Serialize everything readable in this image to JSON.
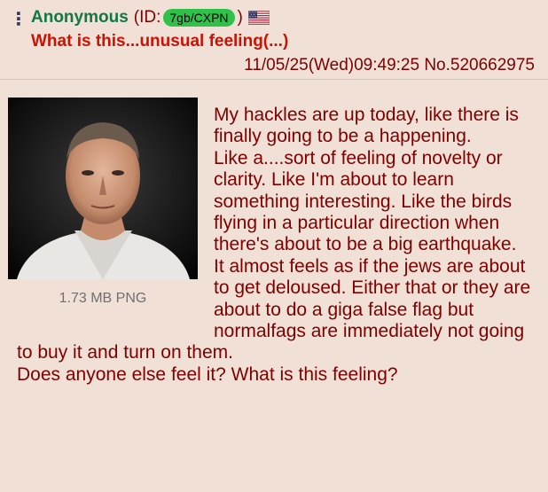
{
  "post": {
    "menu_icon": "vertical-ellipsis-icon",
    "name": "Anonymous",
    "id_prefix": "(ID:",
    "id": "7gb/CXPN",
    "id_suffix": ")",
    "flag_icon": "us-flag-icon",
    "subject": "What is this...unusual feeling(...)",
    "datetime": "11/05/25(Wed)09:49:25",
    "post_number": "No.520662975",
    "file_info": "1.73 MB PNG",
    "body_lines": [
      "My hackles are up today, like there is finally going to be a happening.",
      "Like a....sort of feeling of novelty or clarity. Like I'm about to learn something interesting. Like the birds flying in a particular direction when there's about to be a big earthquake.",
      "It almost feels as if the jews are about to get deloused. Either that or they are about to do a giga false flag but normalfags are immediately not going to buy it and turn on them.",
      "Does anyone else feel it? What is this feeling?"
    ]
  },
  "colors": {
    "background": "#f0e0d6",
    "name": "#117743",
    "subject": "#cc1105",
    "text": "#800000",
    "id_badge": "#2fc14a",
    "file_info": "#707070"
  }
}
